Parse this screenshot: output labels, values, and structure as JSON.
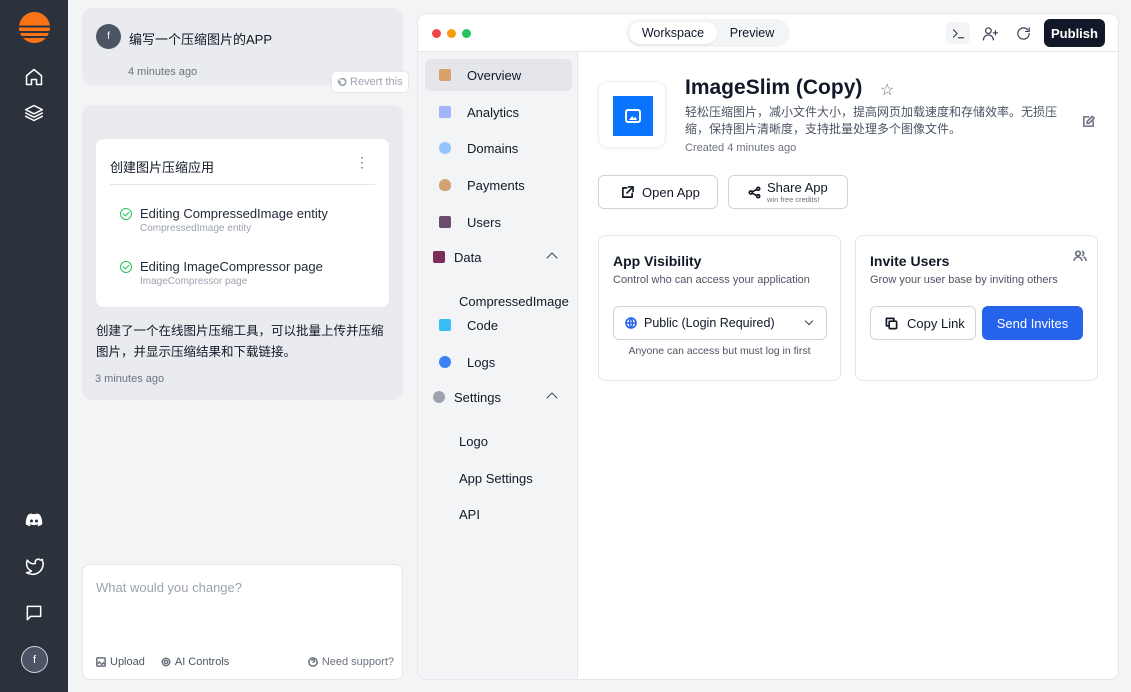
{
  "rail": {
    "logo": "app-logo",
    "nav_icons": [
      "home-icon",
      "layers-icon"
    ],
    "bottom_icons": [
      "discord-icon",
      "twitter-icon",
      "message-icon"
    ],
    "user_initial": "f"
  },
  "chat": {
    "prompt": {
      "avatar_initial": "f",
      "text": "编写一个压缩图片的APP",
      "time": "4 minutes ago",
      "revert_label": "Revert this"
    },
    "reply": {
      "task_title": "创建图片压缩应用",
      "steps": [
        {
          "title": "Editing CompressedImage entity",
          "subtitle": "CompressedImage entity"
        },
        {
          "title": "Editing ImageCompressor page",
          "subtitle": "ImageCompressor page"
        }
      ],
      "text": "创建了一个在线图片压缩工具，可以批量上传并压缩图片，并显示压缩结果和下载链接。",
      "time": "3 minutes ago"
    },
    "composer": {
      "placeholder": "What would you change?",
      "upload_label": "Upload",
      "ai_controls_label": "AI Controls",
      "support_label": "Need support?"
    }
  },
  "window": {
    "tabs": [
      "Workspace",
      "Preview"
    ],
    "publish_label": "Publish",
    "traffic_colors": [
      "#ef4444",
      "#f59e0b",
      "#22c55e"
    ]
  },
  "nav": {
    "items": [
      {
        "label": "Overview",
        "icon": "clipboard-icon",
        "color": "#d9a06b"
      },
      {
        "label": "Analytics",
        "icon": "chart-icon",
        "color": "#a5b4fc"
      },
      {
        "label": "Domains",
        "icon": "globe-icon",
        "color": "#93c5fd"
      },
      {
        "label": "Payments",
        "icon": "money-bag-icon",
        "color": "#d4a373"
      },
      {
        "label": "Users",
        "icon": "users-icon",
        "color": "#6b4c6e"
      },
      {
        "label": "Data",
        "icon": "floppy-icon",
        "color": "#7c2d5a"
      },
      {
        "label": "Code",
        "icon": "book-icon",
        "color": "#38bdf8"
      },
      {
        "label": "Logs",
        "icon": "magnifier-icon",
        "color": "#3b82f6"
      },
      {
        "label": "Settings",
        "icon": "gear-icon",
        "color": "#9ca3af"
      }
    ],
    "data_children": [
      "CompressedImage"
    ],
    "settings_children": [
      "Logo",
      "App Settings",
      "API"
    ]
  },
  "app": {
    "name": "ImageSlim (Copy)",
    "description": "轻松压缩图片，减小文件大小，提高网页加载速度和存储效率。无损压缩，保持图片清晰度，支持批量处理多个图像文件。",
    "created": "Created 4 minutes ago",
    "open_label": "Open App",
    "share_label": "Share App",
    "share_note": "win free credits!",
    "brand_color": "#0b74ff"
  },
  "visibility": {
    "title": "App Visibility",
    "subtitle": "Control who can access your application",
    "selected": "Public (Login Required)",
    "note": "Anyone can access but must log in first"
  },
  "invite": {
    "title": "Invite Users",
    "subtitle": "Grow your user base by inviting others",
    "copy_label": "Copy Link",
    "send_label": "Send Invites",
    "accent": "#2563eb"
  }
}
